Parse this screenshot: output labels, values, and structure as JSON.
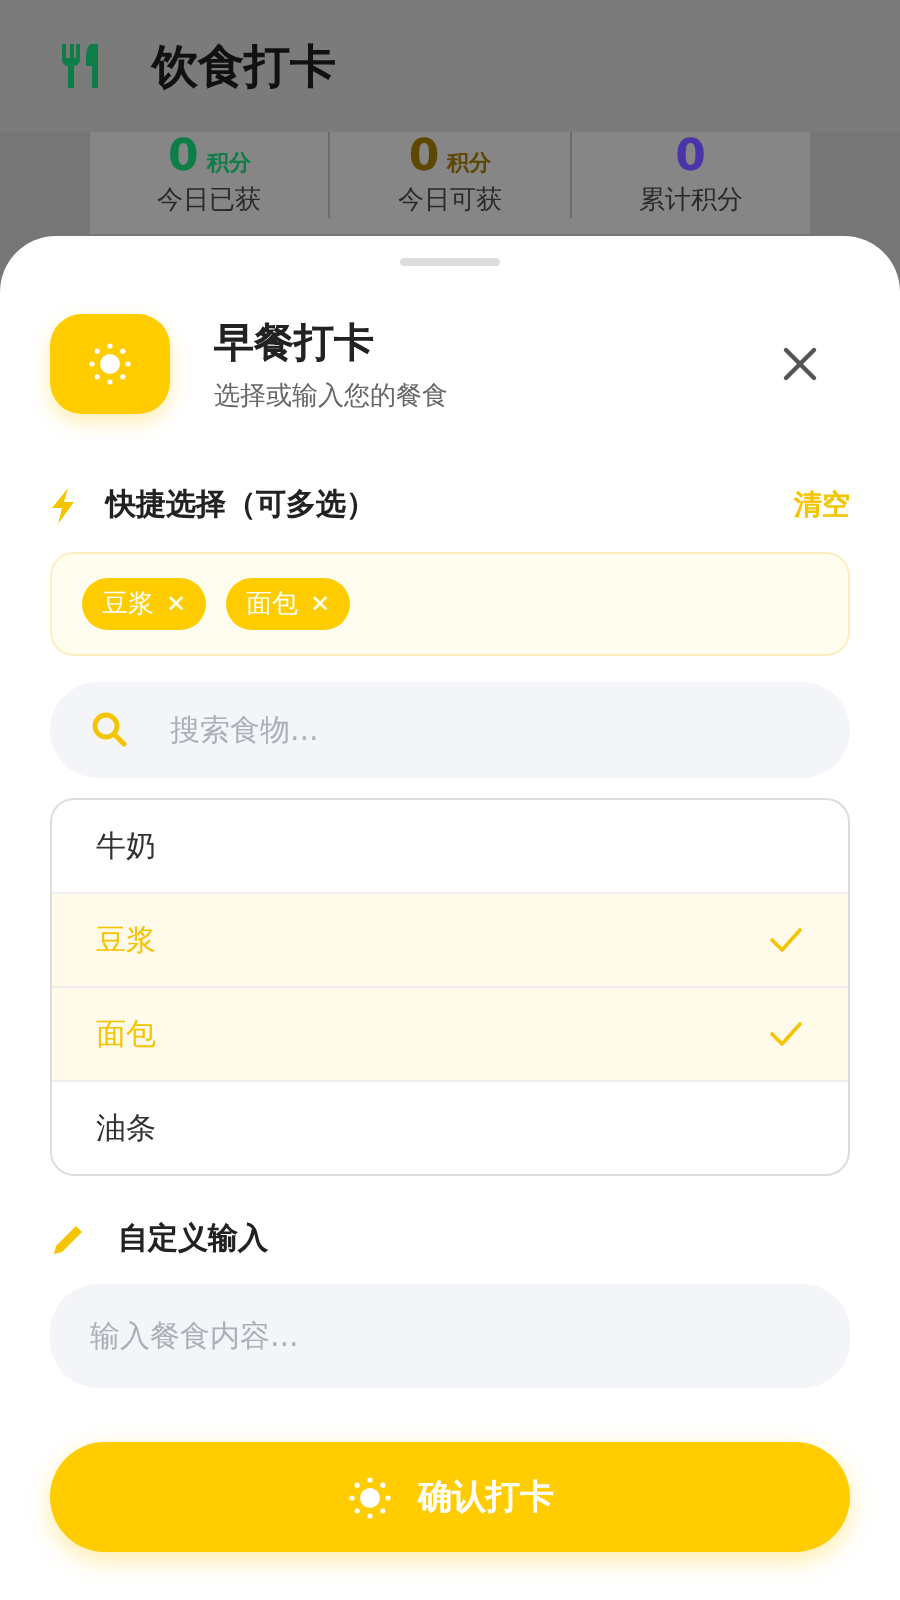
{
  "header": {
    "title": "饮食打卡"
  },
  "stats": [
    {
      "value": "0",
      "unit": "积分",
      "label": "今日已获",
      "color": "#0e7e48"
    },
    {
      "value": "0",
      "unit": "积分",
      "label": "今日可获",
      "color": "#5e4700"
    },
    {
      "value": "0",
      "label": "累计积分",
      "color": "#4a34a8"
    }
  ],
  "sheet": {
    "title": "早餐打卡",
    "subtitle": "选择或输入您的餐食",
    "quick": {
      "title": "快捷选择（可多选）",
      "clear": "清空",
      "chips": [
        {
          "label": "豆浆",
          "remove": "✕"
        },
        {
          "label": "面包",
          "remove": "✕"
        }
      ]
    },
    "search": {
      "placeholder": "搜索食物..."
    },
    "options": [
      {
        "label": "牛奶",
        "selected": false
      },
      {
        "label": "豆浆",
        "selected": true
      },
      {
        "label": "面包",
        "selected": true
      },
      {
        "label": "油条",
        "selected": false
      }
    ],
    "custom": {
      "title": "自定义输入",
      "placeholder": "输入餐食内容..."
    },
    "confirm": "确认打卡"
  }
}
